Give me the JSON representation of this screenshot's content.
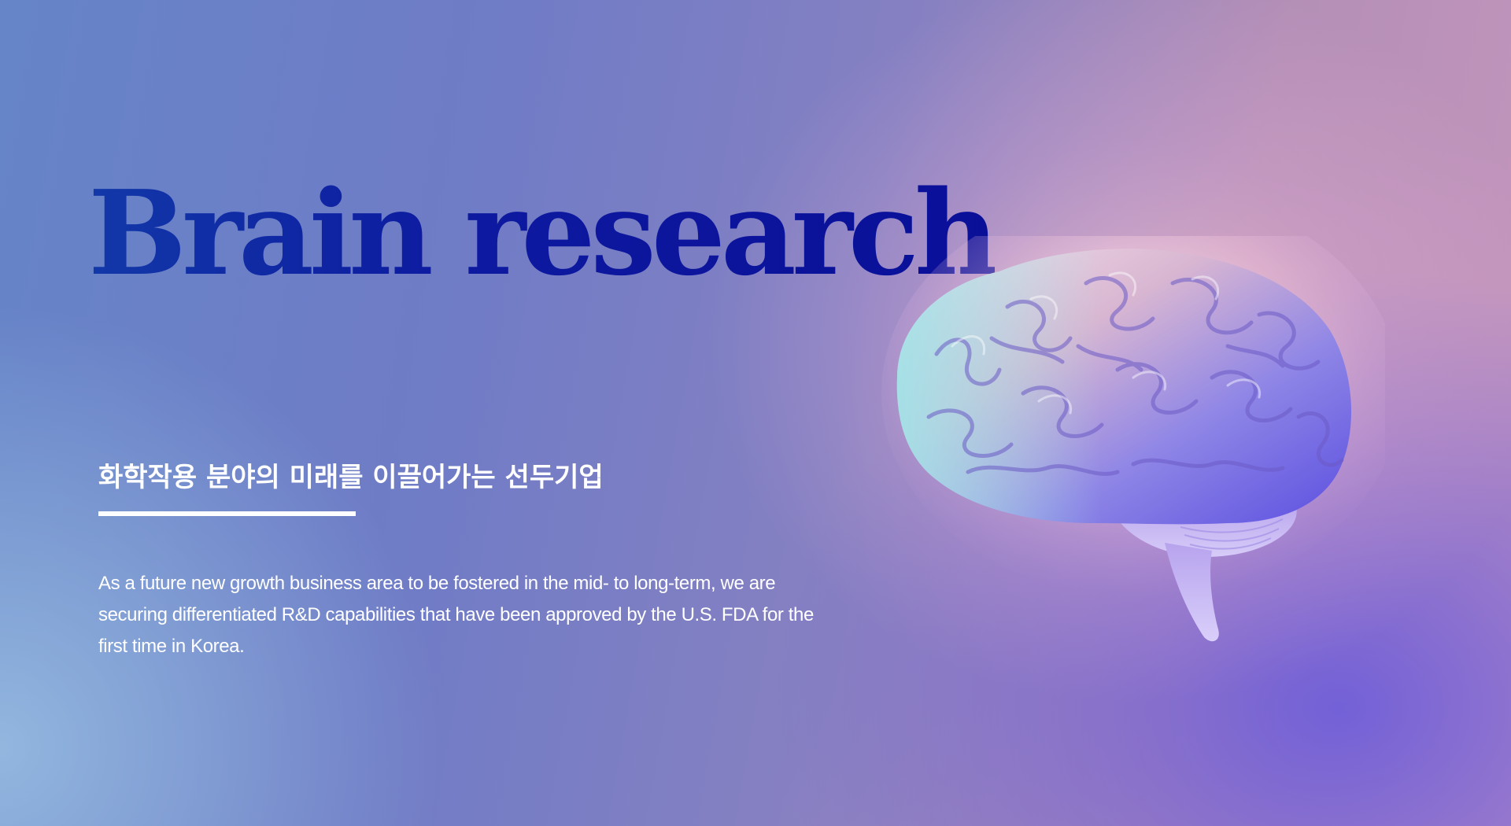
{
  "hero": {
    "title": "Brain research",
    "subtitle": "화학작용 분야의 미래를 이끌어가는 선두기업",
    "description": "As a future new growth business area to be fostered in the mid- to long-term, we are securing differentiated R&D capabilities that have been approved by the U.S. FDA for the first time in Korea."
  },
  "image": {
    "icon": "brain-illustration"
  },
  "colors": {
    "title": "#0f17a8",
    "text": "#ffffff",
    "background_left": "#6684c8",
    "background_right": "#c596be",
    "background_bottom_right": "#5a50e1"
  }
}
